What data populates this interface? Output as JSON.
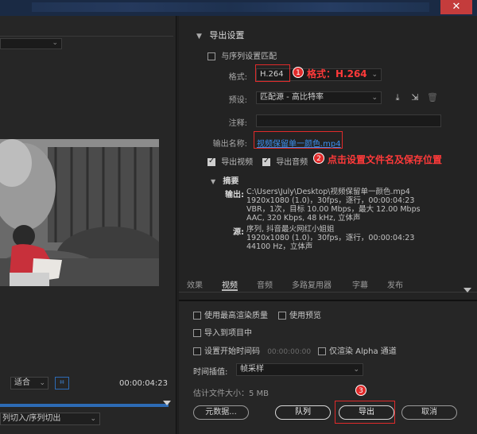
{
  "window": {
    "close_glyph": "✕"
  },
  "left": {
    "fit_select": "适合",
    "timecode": "00:00:04:23",
    "source_range": "列切入/序列切出"
  },
  "export_settings": {
    "section_title": "导出设置",
    "match_sequence_label": "与序列设置匹配",
    "format_label": "格式:",
    "format_value": "H.264",
    "preset_label": "预设:",
    "preset_value": "匹配源 - 高比特率",
    "comments_label": "注释:",
    "output_name_label": "输出名称:",
    "output_name_value": "视频保留单一颜色.mp4",
    "export_video_label": "导出视频",
    "export_audio_label": "导出音频",
    "summary_label": "摘要",
    "summary_output_label": "输出:",
    "summary_output_lines": [
      "C:\\Users\\July\\Desktop\\视频保留单一颜色.mp4",
      "1920x1080 (1.0)，30fps，逐行，00:00:04:23",
      "VBR，1次，目标 10.00 Mbps，最大 12.00 Mbps",
      "AAC, 320 Kbps, 48  kHz, 立体声"
    ],
    "summary_source_label": "源:",
    "summary_source_lines": [
      "序列, 抖音最火网红小姐姐",
      "1920x1080 (1.0)，30fps，逐行，00:00:04:23",
      "44100 Hz，立体声"
    ]
  },
  "annotations": {
    "step1_number": "1",
    "step1_text": "格式：H.264",
    "step2_number": "2",
    "step2_text": "点击设置文件名及保存位置",
    "step3_number": "3",
    "accent_color": "#e02a2a"
  },
  "tabs": [
    "效果",
    "视频",
    "音频",
    "多路复用器",
    "字幕",
    "发布"
  ],
  "active_tab": "视频",
  "bottom": {
    "max_quality": "使用最高渲染质量",
    "use_previews": "使用预览",
    "import_project": "导入到项目中",
    "set_start_tc": "设置开始时间码",
    "start_tc_value": "00:00:00:00",
    "alpha_only": "仅渲染 Alpha 通道",
    "interp_label": "时间插值:",
    "interp_value": "帧采样",
    "file_size": "估计文件大小：5 MB",
    "btn_metadata": "元数据...",
    "btn_queue": "队列",
    "btn_export": "导出",
    "btn_cancel": "取消"
  }
}
